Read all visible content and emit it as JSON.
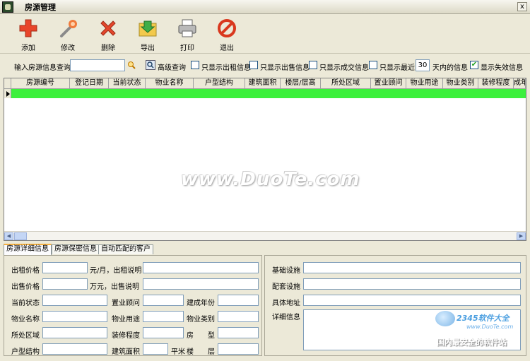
{
  "window": {
    "title": "房源管理",
    "close_glyph": "x"
  },
  "toolbar": [
    {
      "label": "添加",
      "icon": "plus-icon"
    },
    {
      "label": "修改",
      "icon": "wand-icon"
    },
    {
      "label": "删除",
      "icon": "delete-x-icon"
    },
    {
      "label": "导出",
      "icon": "export-folder-icon"
    },
    {
      "label": "打印",
      "icon": "printer-icon"
    },
    {
      "label": "退出",
      "icon": "exit-icon"
    }
  ],
  "filter": {
    "query_label": "输入房源信息查询",
    "query_value": "",
    "advanced_label": "高级查询",
    "rent_only_label": "只显示出租信息",
    "rent_only": false,
    "sale_only_label": "只显示出售信息",
    "sale_only": false,
    "deal_only_label": "只显示成交信息",
    "deal_only": false,
    "recent_label": "只显示最近",
    "recent": false,
    "recent_days": "30",
    "recent_suffix": "天内的信息",
    "show_invalid_label": "显示失效信息",
    "show_invalid": true
  },
  "grid": {
    "columns": [
      "房源编号",
      "登记日期",
      "当前状态",
      "物业名称",
      "户型结构",
      "建筑面积",
      "楼层/层高",
      "所处区域",
      "置业顾问",
      "物业用途",
      "物业类别",
      "装修程度",
      "成年"
    ],
    "selected_row_color": "#3cf03c"
  },
  "watermark": "www.DuoTe.com",
  "tabs": [
    {
      "label": "房源详细信息",
      "active": true
    },
    {
      "label": "房源保密信息",
      "active": false
    },
    {
      "label": "自动匹配的客户",
      "active": false
    }
  ],
  "details": {
    "rent_price": "出租价格",
    "rent_unit": "元/月，出租说明",
    "sale_price": "出售价格",
    "sale_unit": "万元，出售说明",
    "status": "当前状态",
    "consultant": "置业顾问",
    "build_year": "建成年份",
    "property_name": "物业名称",
    "property_use": "物业用途",
    "property_type": "物业类别",
    "region": "所处区域",
    "decoration": "装修程度",
    "room_type": "房　　型",
    "layout": "户型结构",
    "area": "建筑面积",
    "area_unit": "平米",
    "floor": "楼　　层",
    "facilities": "基础设施",
    "supporting": "配套设施",
    "address": "具体地址",
    "detail_info": "详细信息"
  },
  "brand": {
    "name": "2345软件大全",
    "url": "www.DuoTe.com",
    "slogan": "国内最安全的软件站"
  }
}
